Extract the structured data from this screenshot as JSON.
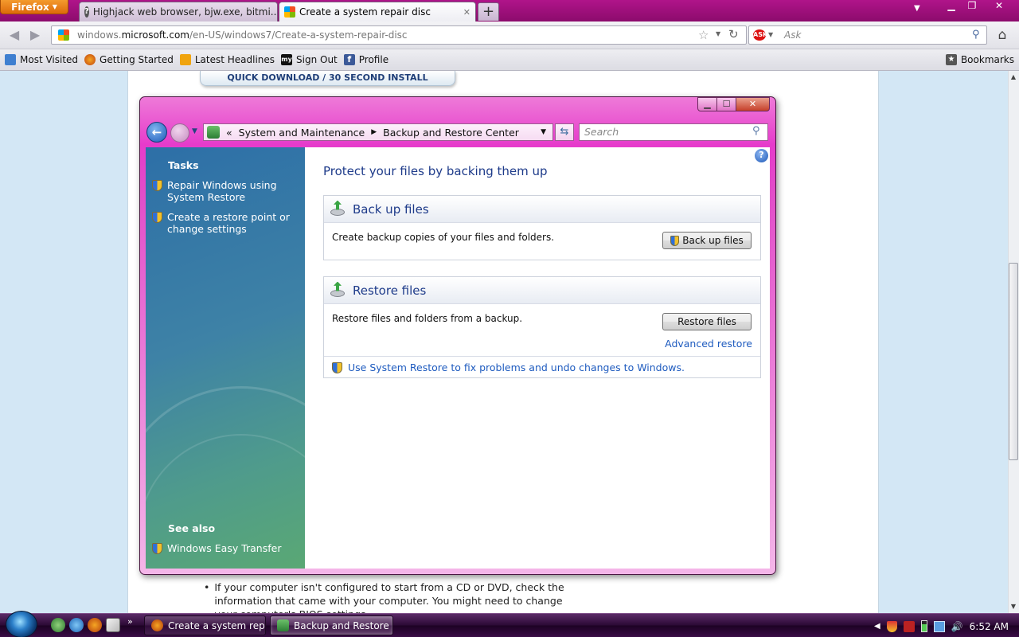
{
  "browser": {
    "app_button": "Firefox",
    "tabs": [
      {
        "label": "Highjack web browser, bjw.exe, bitmi..."
      },
      {
        "label": "Create a system repair disc"
      }
    ],
    "url_prefix": "windows.",
    "url_domain": "microsoft.com",
    "url_path": "/en-US/windows7/Create-a-system-repair-disc",
    "search_placeholder": "Ask",
    "bookmarks": [
      {
        "label": "Most Visited",
        "icon": "most-visited-icon"
      },
      {
        "label": "Getting Started",
        "icon": "firefox-icon"
      },
      {
        "label": "Latest Headlines",
        "icon": "rss-icon"
      },
      {
        "label": "Sign Out",
        "icon": "myspace-icon"
      },
      {
        "label": "Profile",
        "icon": "facebook-icon"
      }
    ],
    "bookmarks_menu": "Bookmarks"
  },
  "webpage": {
    "quick_download": "QUICK DOWNLOAD / 30 SECOND INSTALL",
    "bullet_text": "If your computer isn't configured to start from a CD or DVD, check the information that came with your computer. You might need to change your computer's BIOS settings."
  },
  "window": {
    "breadcrumb_prefix": "«",
    "breadcrumb": [
      "System and Maintenance",
      "Backup and Restore Center"
    ],
    "search_placeholder": "Search",
    "tasks_heading": "Tasks",
    "tasks": [
      {
        "label": "Repair Windows using System Restore"
      },
      {
        "label": "Create a restore point or change settings"
      }
    ],
    "see_also_heading": "See also",
    "see_also": [
      {
        "label": "Windows Easy Transfer"
      }
    ],
    "main_title": "Protect your files by backing them up",
    "backup": {
      "title": "Back up files",
      "description": "Create backup copies of your files and folders.",
      "button": "Back up files"
    },
    "restore": {
      "title": "Restore files",
      "description": "Restore files and folders from a backup.",
      "button": "Restore files",
      "advanced_link": "Advanced restore"
    },
    "system_restore_link": "Use System Restore to fix problems and undo changes to Windows."
  },
  "taskbar": {
    "buttons": [
      {
        "label": "Create a system rep..."
      },
      {
        "label": "Backup and Restore ..."
      }
    ],
    "clock": "6:52 AM"
  }
}
